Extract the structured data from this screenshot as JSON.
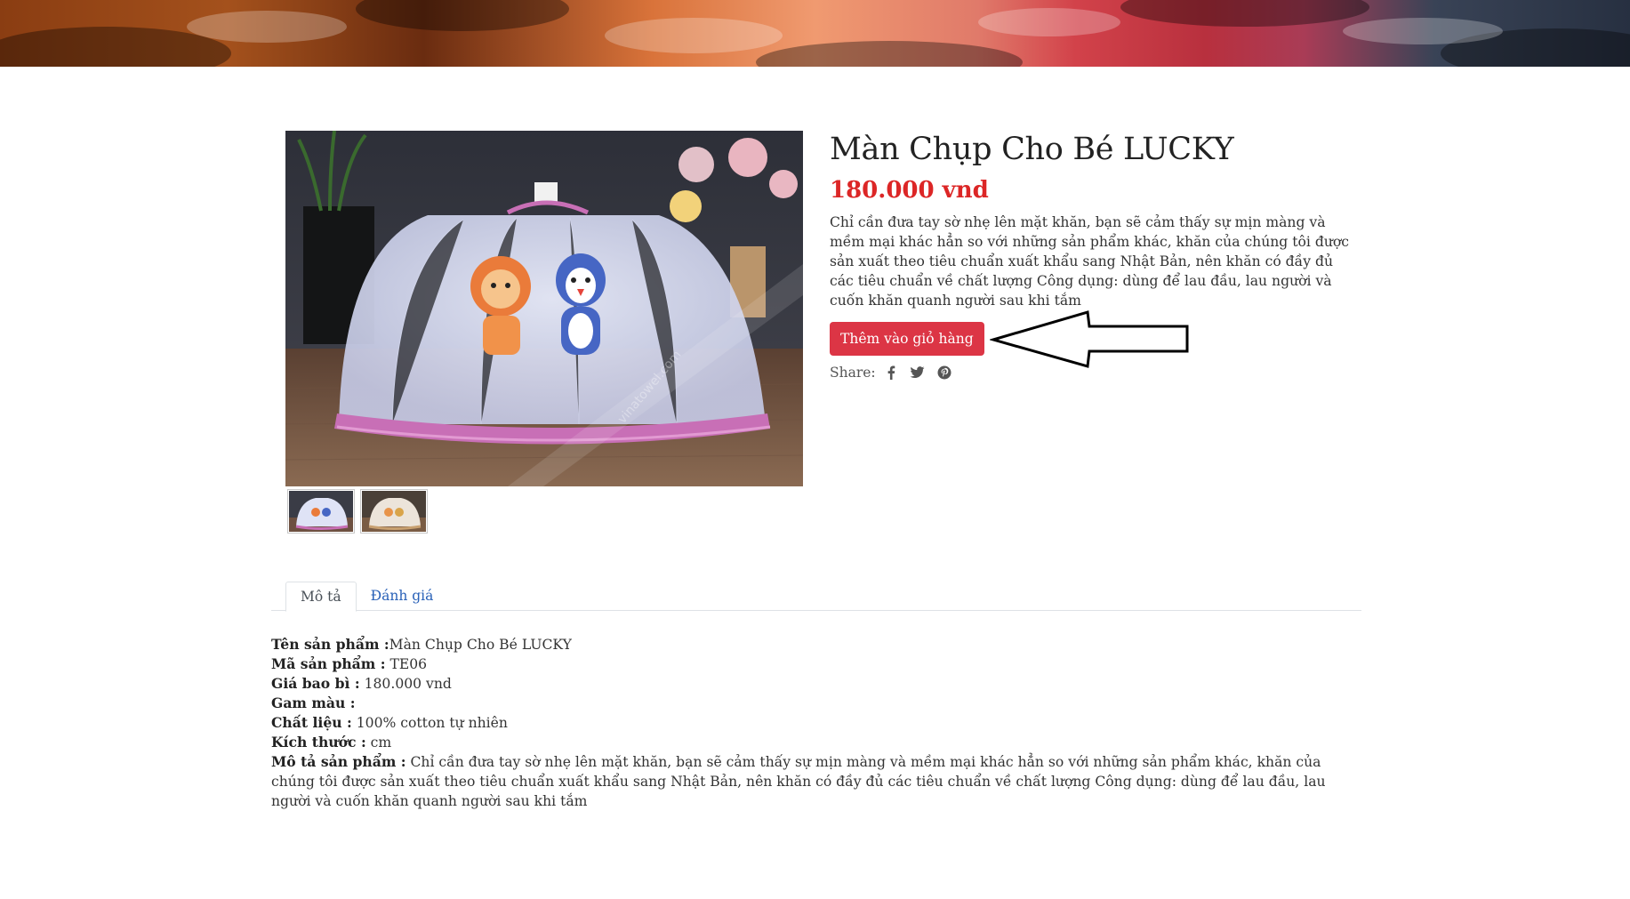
{
  "product": {
    "title": "Màn Chụp Cho Bé LUCKY",
    "price": "180.000 vnd",
    "short_description": "Chỉ cần đưa tay sờ nhẹ lên mặt khăn, bạn sẽ cảm thấy sự mịn màng và mềm mại khác hẳn so với những sản phẩm khác, khăn của chúng tôi được sản xuất theo tiêu chuẩn xuất khẩu sang Nhật Bản, nên khăn có đầy đủ các tiêu chuẩn về chất lượng Công dụng: dùng để lau đầu, lau người và cuốn khăn quanh người sau khi tắm",
    "add_to_cart_label": "Thêm vào giỏ hàng",
    "share_label": "Share:",
    "share_icons": [
      "facebook-icon",
      "twitter-icon",
      "pinterest-icon"
    ],
    "watermark": "vinatowel.com"
  },
  "tabs": [
    {
      "label": "Mô tả",
      "active": true
    },
    {
      "label": "Đánh giá",
      "active": false
    }
  ],
  "details": {
    "name_label": "Tên sản phẩm :",
    "name_value": "Màn Chụp Cho Bé LUCKY",
    "code_label": "Mã sản phẩm :",
    "code_value": "TE06",
    "pack_price_label": "Giá bao bì :",
    "pack_price_value": "180.000 vnd",
    "color_label": "Gam màu :",
    "color_value": "",
    "material_label": "Chất liệu :",
    "material_value": "100% cotton tự nhiên",
    "size_label": "Kích thước :",
    "size_value": "cm",
    "desc_label": "Mô tả sản phẩm :",
    "desc_value": "Chỉ cần đưa tay sờ nhẹ lên mặt khăn, bạn sẽ cảm thấy sự mịn màng và mềm mại khác hẳn so với những sản phẩm khác, khăn của chúng tôi được sản xuất theo tiêu chuẩn xuất khẩu sang Nhật Bản, nên khăn có đầy đủ các tiêu chuẩn về chất lượng Công dụng: dùng để lau đầu, lau người và cuốn khăn quanh người sau khi tắm"
  },
  "colors": {
    "accent_red": "#dc3545",
    "price_red": "#dc2626",
    "tab_link_blue": "#2a62b8"
  }
}
